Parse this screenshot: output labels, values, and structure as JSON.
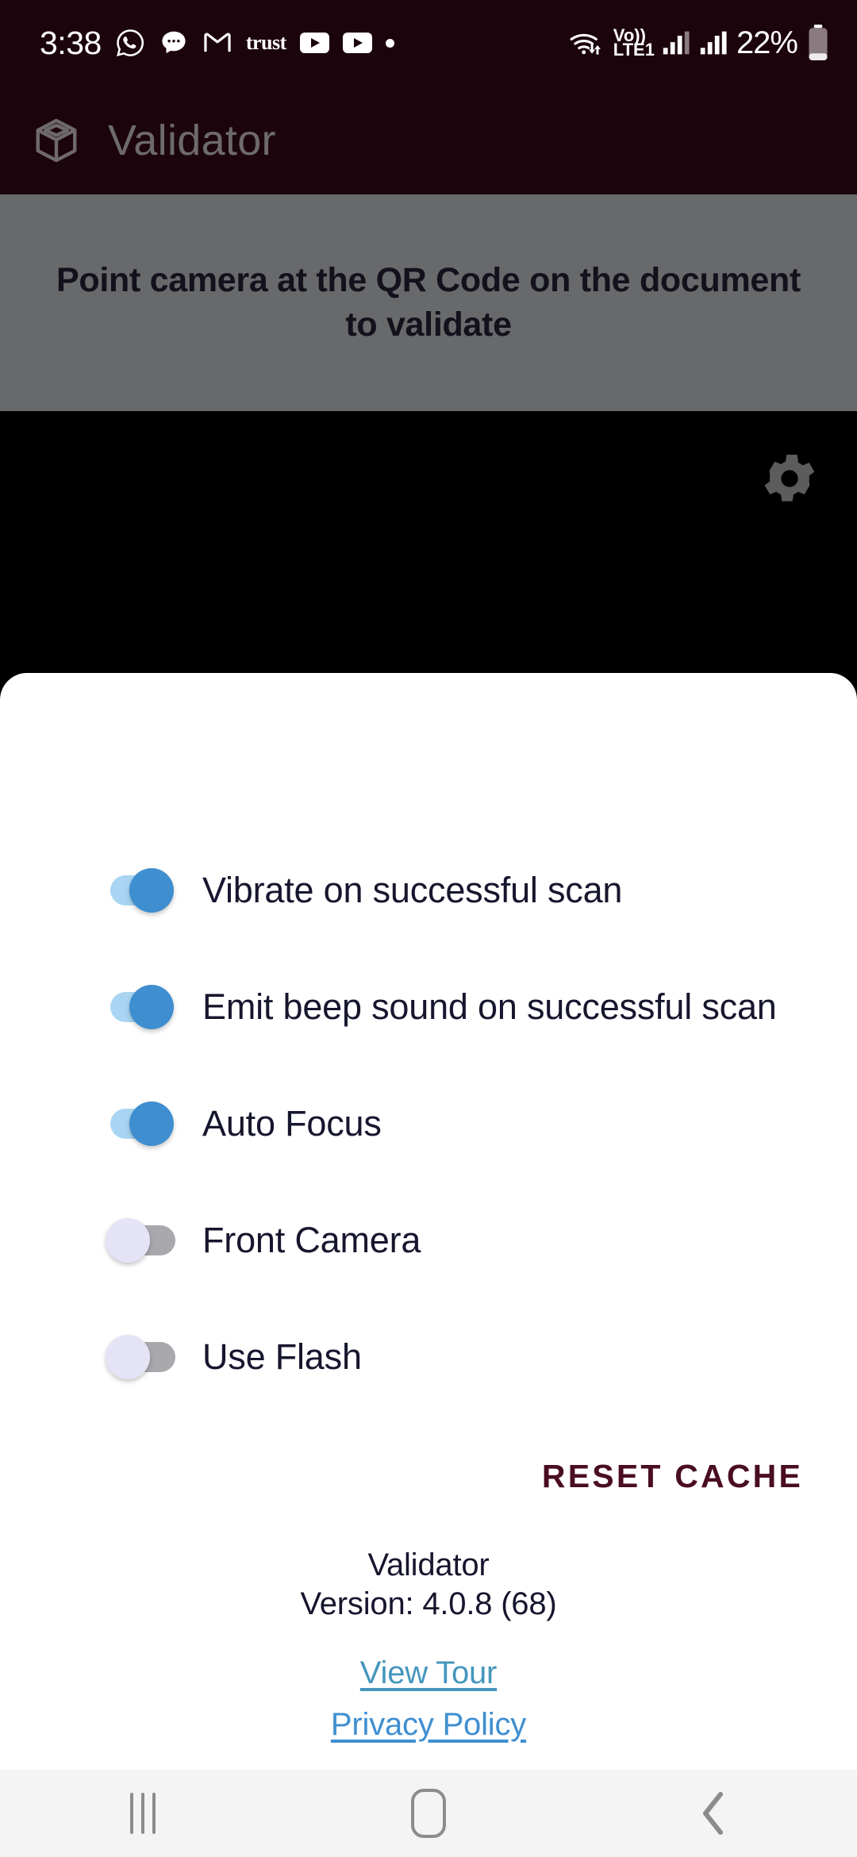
{
  "status_bar": {
    "time": "3:38",
    "battery_percent": "22%",
    "network_label_top": "Vo))",
    "network_label_bottom": "LTE1",
    "trust_label": "trust",
    "icons": [
      "whatsapp-icon",
      "messages-icon",
      "gmail-icon",
      "trust-wallet-icon",
      "youtube-icon",
      "youtube-icon",
      "dot-icon",
      "wifi-icon",
      "volte-icon",
      "signal-icon",
      "signal-icon",
      "battery-icon"
    ]
  },
  "app_bar": {
    "title": "Validator",
    "icon": "cube-icon"
  },
  "banner": {
    "text": "Point camera at the QR Code on the document to validate"
  },
  "camera": {
    "settings_icon": "gear-icon"
  },
  "settings": {
    "toggles": [
      {
        "label": "Vibrate on successful scan",
        "state": "on"
      },
      {
        "label": "Emit beep sound on successful scan",
        "state": "on"
      },
      {
        "label": "Auto Focus",
        "state": "on"
      },
      {
        "label": "Front Camera",
        "state": "off"
      },
      {
        "label": "Use Flash",
        "state": "off"
      }
    ],
    "reset_label": "RESET CACHE",
    "app_name": "Validator",
    "version": "Version: 4.0.8 (68)",
    "links": [
      {
        "label": "View Tour"
      },
      {
        "label": "Privacy Policy"
      }
    ]
  },
  "nav_bar": {
    "recents": "recents-icon",
    "home": "home-icon",
    "back": "back-icon"
  },
  "colors": {
    "header_bg": "#1c040d",
    "banner_bg": "#67696b",
    "toggle_on_thumb": "#3e8ed0",
    "toggle_on_track": "#a9d5f2",
    "toggle_off_thumb": "#e4e4f6",
    "toggle_off_track": "#a8a8ad",
    "reset_text": "#4a0d23",
    "link_tour": "#4596bd",
    "link_privacy": "#3f8fd1"
  }
}
